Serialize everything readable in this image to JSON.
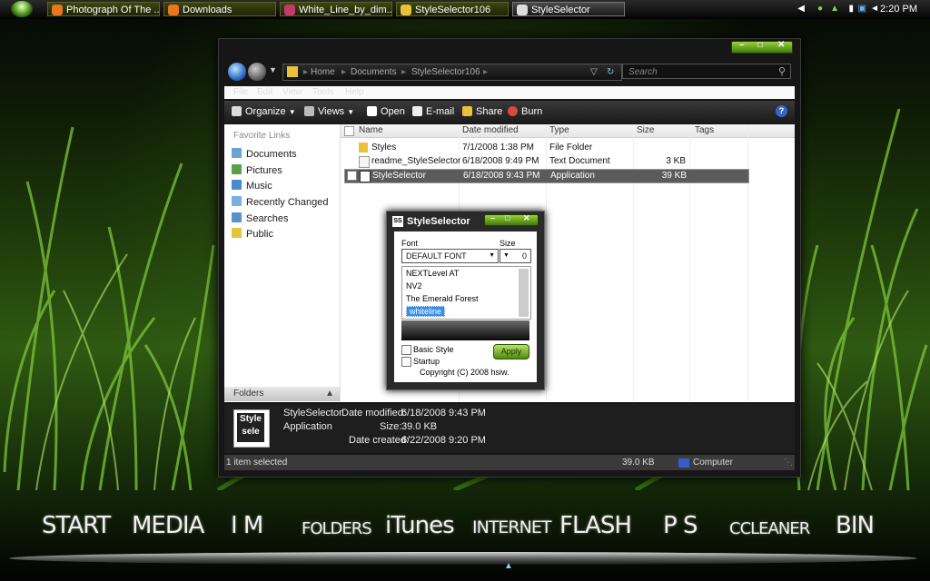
{
  "taskbar": {
    "tasks": [
      {
        "label": "Photograph Of The ...",
        "icon": "firefox-icon"
      },
      {
        "label": "Downloads",
        "icon": "firefox-icon"
      },
      {
        "label": "White_Line_by_dim...",
        "icon": "image-icon"
      },
      {
        "label": "StyleSelector106",
        "icon": "folder-icon"
      },
      {
        "label": "StyleSelector",
        "icon": "app-icon"
      }
    ],
    "clock": "2:20 PM"
  },
  "explorer": {
    "breadcrumb": [
      "Home",
      "Documents",
      "StyleSelector106"
    ],
    "search_placeholder": "Search",
    "menu": [
      "File",
      "Edit",
      "View",
      "Tools",
      "Help"
    ],
    "toolbar": [
      "Organize",
      "Views",
      "Open",
      "E-mail",
      "Share",
      "Burn"
    ],
    "nav": {
      "header": "Favorite Links",
      "items": [
        "Documents",
        "Pictures",
        "Music",
        "Recently Changed",
        "Searches",
        "Public"
      ],
      "folders_label": "Folders"
    },
    "columns": [
      "Name",
      "Date modified",
      "Type",
      "Size",
      "Tags"
    ],
    "files": [
      {
        "name": "Styles",
        "date": "7/1/2008 1:38 PM",
        "type": "File Folder",
        "size": ""
      },
      {
        "name": "readme_StyleSelector",
        "date": "6/18/2008 9:49 PM",
        "type": "Text Document",
        "size": "3 KB"
      },
      {
        "name": "StyleSelector",
        "date": "6/18/2008 9:43 PM",
        "type": "Application",
        "size": "39 KB"
      }
    ],
    "details": {
      "name": "StyleSelector",
      "kind": "Application",
      "date_modified_label": "Date modified:",
      "date_modified": "6/18/2008 9:43 PM",
      "size_label": "Size:",
      "size": "39.0 KB",
      "date_created_label": "Date created:",
      "date_created": "6/22/2008 9:20 PM",
      "thumb_text": "Style sele"
    },
    "status": {
      "selected": "1 item selected",
      "size": "39.0 KB",
      "location": "Computer"
    }
  },
  "dialog": {
    "title": "StyleSelector",
    "font_label": "Font",
    "size_label": "Size",
    "font_value": "DEFAULT FONT",
    "size_value": "0",
    "styles": [
      "NEXTLevel AT",
      "NV2",
      "The Emerald Forest",
      "whiteline"
    ],
    "basic_style": "Basic Style",
    "startup": "Startup",
    "apply": "Apply",
    "copyright": "Copyright (C) 2008 hsiw."
  },
  "dock": [
    "START",
    "MEDIA",
    "I M",
    "FOLDERS",
    "iTunes",
    "INTERNET",
    "FLASH",
    "P S",
    "CCLEANER",
    "BIN"
  ]
}
